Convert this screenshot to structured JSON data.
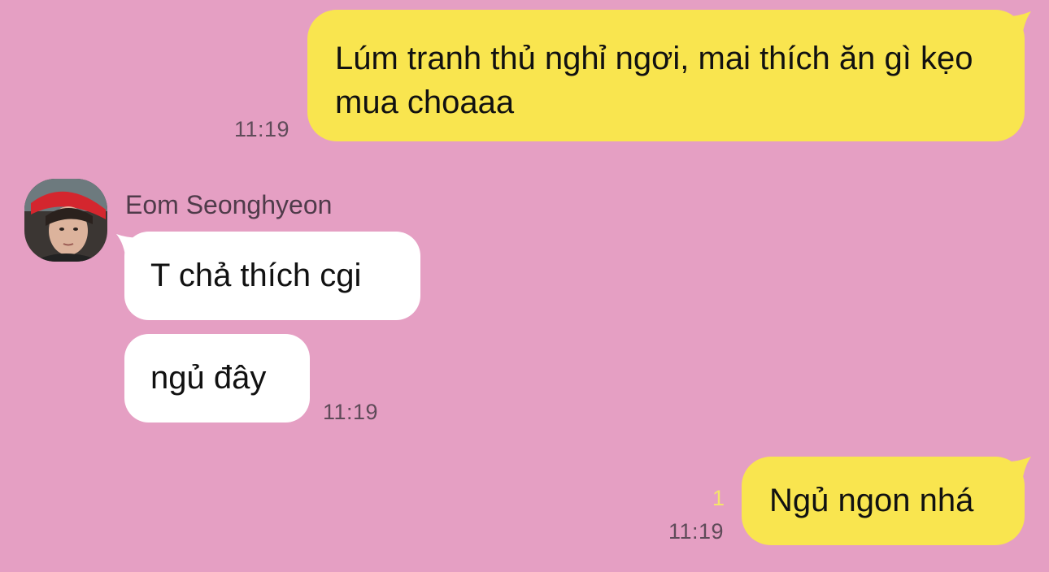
{
  "colors": {
    "background": "#e59fc3",
    "outgoing_bubble": "#f9e54f",
    "incoming_bubble": "#ffffff",
    "timestamp": "#5f4b59",
    "unread_count": "#f5e56a"
  },
  "messages": {
    "out1": {
      "text": "Lúm tranh thủ nghỉ ngơi, mai thích ăn gì kẹo mua choaaa",
      "time": "11:19"
    },
    "sender": {
      "name": "Eom Seonghyeon",
      "avatar_icon": "profile-photo"
    },
    "in1": {
      "text": "T chả thích cgi"
    },
    "in2": {
      "text": "ngủ đây",
      "time": "11:19"
    },
    "out2": {
      "text": "Ngủ ngon nhá",
      "unread": "1",
      "time": "11:19"
    }
  }
}
